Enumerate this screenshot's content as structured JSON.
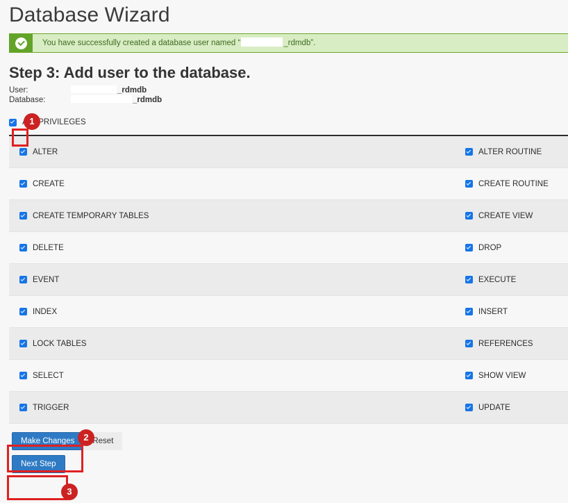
{
  "page": {
    "title": "Database Wizard"
  },
  "alert": {
    "icon": "check-circle-icon",
    "text_before": "You have successfully created a database user named “",
    "text_after": "_rdmdb”.",
    "bg_color": "#d9edc4",
    "icon_bg_color": "#63a329",
    "text_color": "#3f6b20"
  },
  "step": {
    "heading": "Step 3: Add user to the database."
  },
  "info": {
    "user_label": "User:",
    "user_value": "_rdmdb",
    "database_label": "Database:",
    "database_value": "_rdmdb"
  },
  "all_privileges": {
    "label": "ALL PRIVILEGES",
    "checked": true
  },
  "privileges": [
    {
      "left": "ALTER",
      "right": "ALTER ROUTINE"
    },
    {
      "left": "CREATE",
      "right": "CREATE ROUTINE"
    },
    {
      "left": "CREATE TEMPORARY TABLES",
      "right": "CREATE VIEW"
    },
    {
      "left": "DELETE",
      "right": "DROP"
    },
    {
      "left": "EVENT",
      "right": "EXECUTE"
    },
    {
      "left": "INDEX",
      "right": "INSERT"
    },
    {
      "left": "LOCK TABLES",
      "right": "REFERENCES"
    },
    {
      "left": "SELECT",
      "right": "SHOW VIEW"
    },
    {
      "left": "TRIGGER",
      "right": "UPDATE"
    }
  ],
  "buttons": {
    "make_changes": "Make Changes",
    "reset": "Reset",
    "next_step": "Next Step",
    "primary_color": "#2e7ac4"
  },
  "annotations": {
    "badge1": "1",
    "badge2": "2",
    "badge3": "3",
    "color": "#cc2222",
    "box_color": "#e02020"
  }
}
